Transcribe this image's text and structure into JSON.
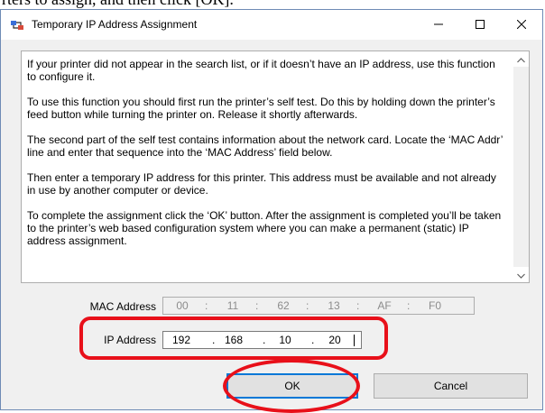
{
  "doc_fragment": "rters to assign, and then click [OK].",
  "window": {
    "title": "Temporary IP Address Assignment",
    "icons": {
      "app": "network-printer-icon",
      "minimize": "minimize-icon",
      "maximize": "maximize-icon",
      "close": "close-icon"
    }
  },
  "info": {
    "paragraphs": [
      "If your printer did not appear in the search list, or if it doesn’t have an IP address, use this function to configure it.",
      "To use this function you should first run the printer’s self test.  Do this by holding down the printer’s feed button while turning the printer on.  Release it shortly afterwards.",
      "The second part of the self test contains information about the network card.  Locate the ‘MAC Addr’ line and enter that sequence into the ‘MAC Address’ field below.",
      "Then enter a temporary IP address for this printer.  This address must be available and not already in use by another computer or device.",
      "To complete the assignment click the ‘OK’ button.  After the assignment is completed you’ll be taken to the printer’s web based configuration system where you can make a permanent (static) IP address assignment."
    ]
  },
  "form": {
    "mac_label": "MAC Address",
    "mac_segments": [
      "00",
      "11",
      "62",
      "13",
      "AF",
      "F0"
    ],
    "ip_label": "IP Address",
    "ip_segments": [
      "192",
      "168",
      "10",
      "20"
    ]
  },
  "buttons": {
    "ok": "OK",
    "cancel": "Cancel"
  },
  "colors": {
    "annotation": "#e8101a",
    "focus": "#0078d7"
  }
}
